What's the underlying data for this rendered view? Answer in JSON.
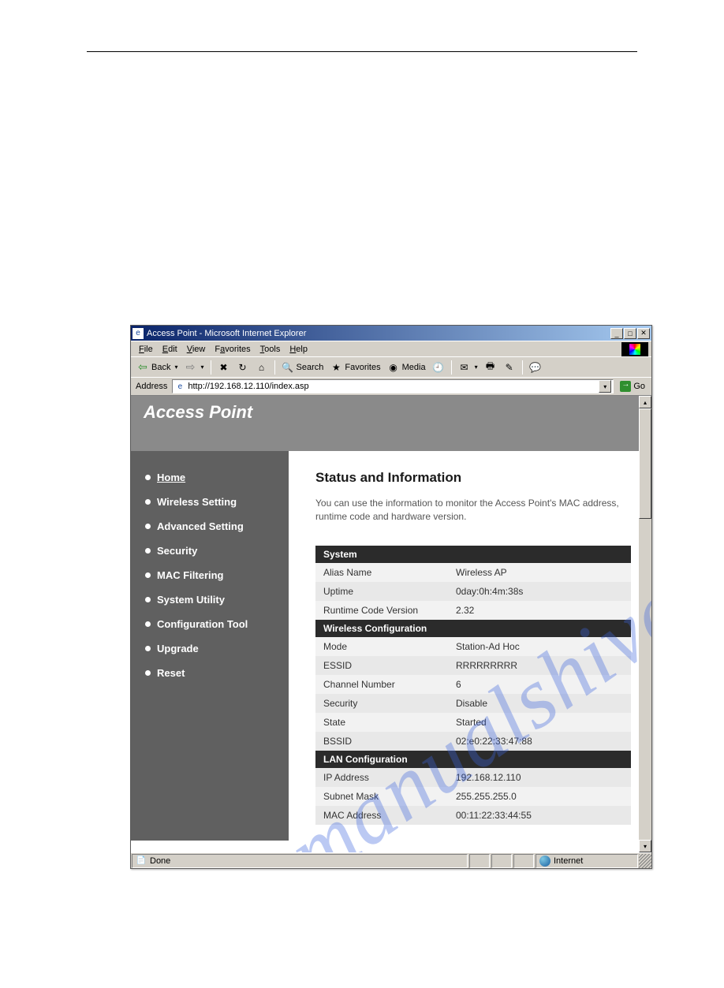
{
  "window": {
    "title": "Access Point - Microsoft Internet Explorer"
  },
  "menu": {
    "items": [
      "File",
      "Edit",
      "View",
      "Favorites",
      "Tools",
      "Help"
    ]
  },
  "toolbar": {
    "back": "Back",
    "search": "Search",
    "favorites": "Favorites",
    "media": "Media"
  },
  "addressbar": {
    "label": "Address",
    "url": "http://192.168.12.110/index.asp",
    "go": "Go"
  },
  "header": {
    "title": "Access Point"
  },
  "sidebar": {
    "items": [
      {
        "label": "Home",
        "active": true
      },
      {
        "label": "Wireless Setting",
        "active": false
      },
      {
        "label": "Advanced Setting",
        "active": false
      },
      {
        "label": "Security",
        "active": false
      },
      {
        "label": "MAC Filtering",
        "active": false
      },
      {
        "label": "System Utility",
        "active": false
      },
      {
        "label": "Configuration Tool",
        "active": false
      },
      {
        "label": "Upgrade",
        "active": false
      },
      {
        "label": "Reset",
        "active": false
      }
    ]
  },
  "main": {
    "heading": "Status and Information",
    "description": "You can use the information to monitor the Access Point's MAC address, runtime code and hardware version.",
    "sections": [
      {
        "title": "System",
        "rows": [
          {
            "key": "Alias Name",
            "value": "Wireless AP"
          },
          {
            "key": "Uptime",
            "value": "0day:0h:4m:38s"
          },
          {
            "key": "Runtime Code Version",
            "value": "2.32"
          }
        ]
      },
      {
        "title": "Wireless Configuration",
        "rows": [
          {
            "key": "Mode",
            "value": "Station-Ad Hoc"
          },
          {
            "key": "ESSID",
            "value": "RRRRRRRRR"
          },
          {
            "key": "Channel Number",
            "value": "6"
          },
          {
            "key": "Security",
            "value": "Disable"
          },
          {
            "key": "State",
            "value": "Started"
          },
          {
            "key": "BSSID",
            "value": "02:e0:22:33:47:88"
          }
        ]
      },
      {
        "title": "LAN Configuration",
        "rows": [
          {
            "key": "IP Address",
            "value": "192.168.12.110"
          },
          {
            "key": "Subnet Mask",
            "value": "255.255.255.0"
          },
          {
            "key": "MAC Address",
            "value": "00:11:22:33:44:55"
          }
        ]
      }
    ]
  },
  "statusbar": {
    "status": "Done",
    "zone": "Internet"
  },
  "watermark": "manualshive.com"
}
